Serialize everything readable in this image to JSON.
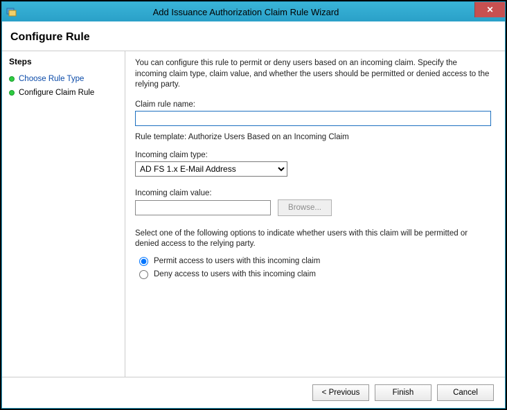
{
  "window": {
    "title": "Add Issuance Authorization Claim Rule Wizard"
  },
  "header": {
    "title": "Configure Rule"
  },
  "sidebar": {
    "title": "Steps",
    "items": [
      {
        "label": "Choose Rule Type",
        "state": "link"
      },
      {
        "label": "Configure Claim Rule",
        "state": "current"
      }
    ]
  },
  "main": {
    "description": "You can configure this rule to permit or deny users based on an incoming claim. Specify the incoming claim type, claim value, and whether the users should be permitted or denied access to the relying party.",
    "claim_rule_name_label": "Claim rule name:",
    "claim_rule_name_value": "",
    "rule_template_label": "Rule template: Authorize Users Based on an Incoming Claim",
    "incoming_claim_type_label": "Incoming claim type:",
    "incoming_claim_type_value": "AD FS 1.x E-Mail Address",
    "incoming_claim_value_label": "Incoming claim value:",
    "incoming_claim_value_value": "",
    "browse_label": "Browse...",
    "select_instructions": "Select one of the following options to indicate whether users with this claim will be permitted or denied access to the relying party.",
    "radio_permit_label": "Permit access to users with this incoming claim",
    "radio_deny_label": "Deny access to users with this incoming claim",
    "radio_selected": "permit"
  },
  "footer": {
    "previous_label": "< Previous",
    "finish_label": "Finish",
    "cancel_label": "Cancel"
  }
}
